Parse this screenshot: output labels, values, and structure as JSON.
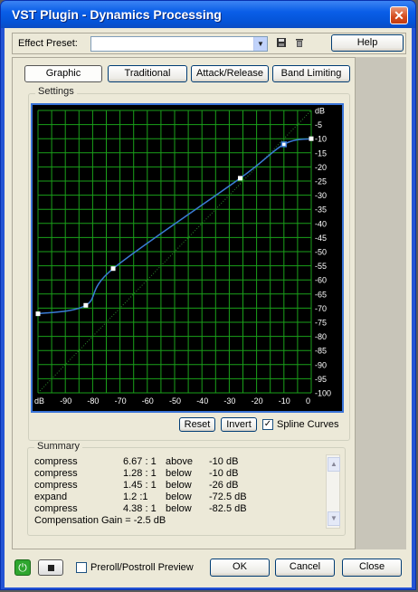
{
  "window": {
    "title": "VST Plugin - Dynamics Processing",
    "close_glyph": "✕"
  },
  "preset": {
    "label": "Effect Preset:",
    "value": "",
    "save_icon": "save-icon",
    "delete_icon": "trash-icon"
  },
  "help_button": "Help",
  "tabs": [
    {
      "label": "Graphic",
      "selected": true
    },
    {
      "label": "Traditional",
      "selected": false
    },
    {
      "label": "Attack/Release",
      "selected": false
    },
    {
      "label": "Band Limiting",
      "selected": false
    }
  ],
  "settings_label": "Settings",
  "graph": {
    "right_labels": [
      "dB",
      "-5",
      "-10",
      "-15",
      "-20",
      "-25",
      "-30",
      "-35",
      "-40",
      "-45",
      "-50",
      "-55",
      "-60",
      "-65",
      "-70",
      "-75",
      "-80",
      "-85",
      "-90",
      "-95",
      "-100"
    ],
    "bottom_labels": [
      "dB",
      "-90",
      "-80",
      "-70",
      "-60",
      "-50",
      "-40",
      "-30",
      "-20",
      "-10",
      "0"
    ],
    "grid_color": "#1aa01a",
    "curve_color": "#3a7bd5",
    "control_points": [
      {
        "input_db": -100,
        "output_db": -72
      },
      {
        "input_db": -82.5,
        "output_db": -69
      },
      {
        "input_db": -72.5,
        "output_db": -56
      },
      {
        "input_db": -26,
        "output_db": -24
      },
      {
        "input_db": -10,
        "output_db": -12
      },
      {
        "input_db": 0,
        "output_db": -10
      }
    ]
  },
  "graph_buttons": {
    "reset": "Reset",
    "invert": "Invert",
    "spline": "Spline Curves",
    "spline_checked": true
  },
  "summary": {
    "label": "Summary",
    "rows": [
      {
        "type": "compress",
        "ratio": "6.67 : 1",
        "dir": "above",
        "thresh": "-10 dB"
      },
      {
        "type": "compress",
        "ratio": "1.28 : 1",
        "dir": "below",
        "thresh": "-10 dB"
      },
      {
        "type": "compress",
        "ratio": "1.45 : 1",
        "dir": "below",
        "thresh": "-26 dB"
      },
      {
        "type": "expand",
        "ratio": "1.2 :1",
        "dir": "below",
        "thresh": "-72.5 dB"
      },
      {
        "type": "compress",
        "ratio": "4.38 : 1",
        "dir": "below",
        "thresh": "-82.5 dB"
      }
    ],
    "gain": "Compensation Gain = -2.5 dB"
  },
  "footer": {
    "preroll": "Preroll/Postroll Preview",
    "preroll_checked": false,
    "ok": "OK",
    "cancel": "Cancel",
    "close": "Close"
  }
}
